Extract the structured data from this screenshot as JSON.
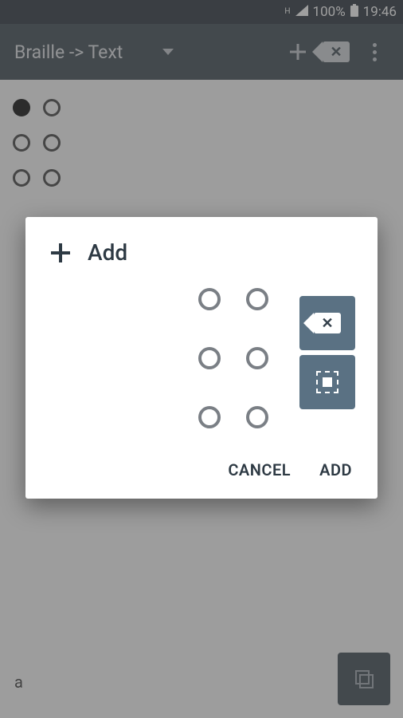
{
  "status": {
    "network_type": "H",
    "battery_pct": "100%",
    "time": "19:46"
  },
  "appbar": {
    "mode_label": "Braille -> Text"
  },
  "main_braille": {
    "dots": [
      true,
      false,
      false,
      false,
      false,
      false
    ]
  },
  "output": {
    "text": "a"
  },
  "dialog": {
    "title": "Add",
    "braille_dots": [
      false,
      false,
      false,
      false,
      false,
      false
    ],
    "cancel_label": "CANCEL",
    "add_label": "ADD"
  }
}
